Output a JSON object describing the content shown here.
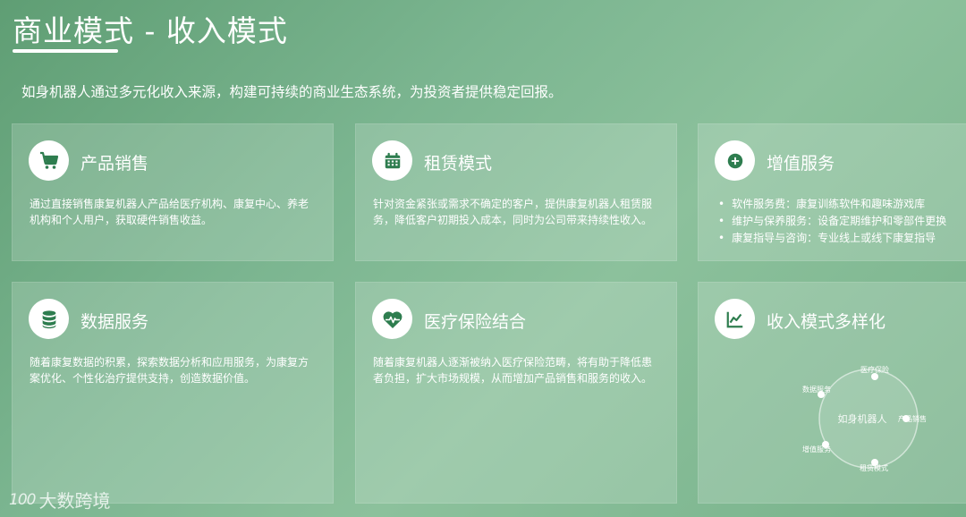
{
  "header": {
    "title": "商业模式 - 收入模式",
    "subtitle": "如身机器人通过多元化收入来源，构建可持续的商业生态系统，为投资者提供稳定回报。"
  },
  "cards": [
    {
      "icon": "shopping-cart-icon",
      "title": "产品销售",
      "desc": "通过直接销售康复机器人产品给医疗机构、康复中心、养老机构和个人用户，获取硬件销售收益。"
    },
    {
      "icon": "calendar-icon",
      "title": "租赁模式",
      "desc": "针对资金紧张或需求不确定的客户，提供康复机器人租赁服务，降低客户初期投入成本，同时为公司带来持续性收入。"
    },
    {
      "icon": "plus-circle-icon",
      "title": "增值服务",
      "items": [
        "软件服务费：康复训练软件和趣味游戏库",
        "维护与保养服务：设备定期维护和零部件更换",
        "康复指导与咨询：专业线上或线下康复指导"
      ]
    },
    {
      "icon": "database-icon",
      "title": "数据服务",
      "desc": "随着康复数据的积累，探索数据分析和应用服务，为康复方案优化、个性化治疗提供支持，创造数据价值。"
    },
    {
      "icon": "heart-pulse-icon",
      "title": "医疗保险结合",
      "desc": "随着康复机器人逐渐被纳入医疗保险范畴，将有助于降低患者负担，扩大市场规模，从而增加产品销售和服务的收入。"
    },
    {
      "icon": "line-chart-icon",
      "title": "收入模式多样化",
      "diagram": {
        "center": "如身机器人",
        "nodes": [
          "医疗保险",
          "产品销售",
          "租赁模式",
          "增值服务",
          "数据服务"
        ]
      }
    }
  ],
  "watermark": {
    "logo": "100",
    "text": "大数跨境"
  },
  "colors": {
    "icon": "#2e7d4f",
    "background_start": "#5f9e74",
    "background_end": "#8cc19c"
  }
}
